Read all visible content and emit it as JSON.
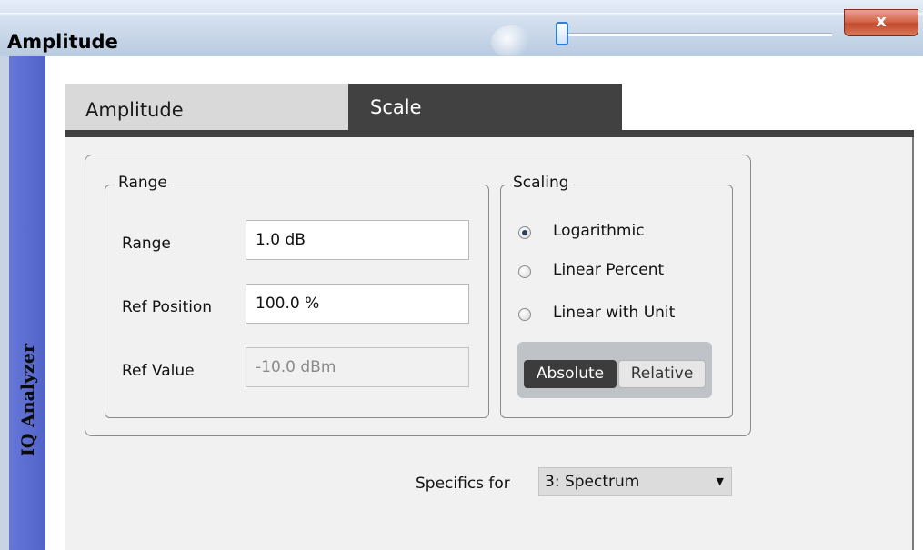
{
  "window": {
    "title": "Amplitude",
    "close_glyph": "x"
  },
  "sidebar": {
    "label": "IQ Analyzer"
  },
  "tabs": [
    {
      "label": "Amplitude",
      "selected": false
    },
    {
      "label": "Scale",
      "selected": true
    }
  ],
  "range_group": {
    "legend": "Range",
    "rows": [
      {
        "label": "Range",
        "value": "1.0 dB",
        "enabled": true
      },
      {
        "label": "Ref Position",
        "value": "100.0 %",
        "enabled": true
      },
      {
        "label": "Ref Value",
        "value": "-10.0 dBm",
        "enabled": false
      }
    ]
  },
  "scaling_group": {
    "legend": "Scaling",
    "options": [
      {
        "label": "Logarithmic",
        "checked": true
      },
      {
        "label": "Linear Percent",
        "checked": false
      },
      {
        "label": "Linear with Unit",
        "checked": false
      }
    ],
    "toggle": {
      "absolute": "Absolute",
      "relative": "Relative",
      "selected": "Absolute"
    }
  },
  "specifics": {
    "label": "Specifics for",
    "selected": "3: Spectrum"
  },
  "colors": {
    "sideband": "#5d6fd2",
    "active_tab": "#414141",
    "close_button": "#c24a2c"
  }
}
